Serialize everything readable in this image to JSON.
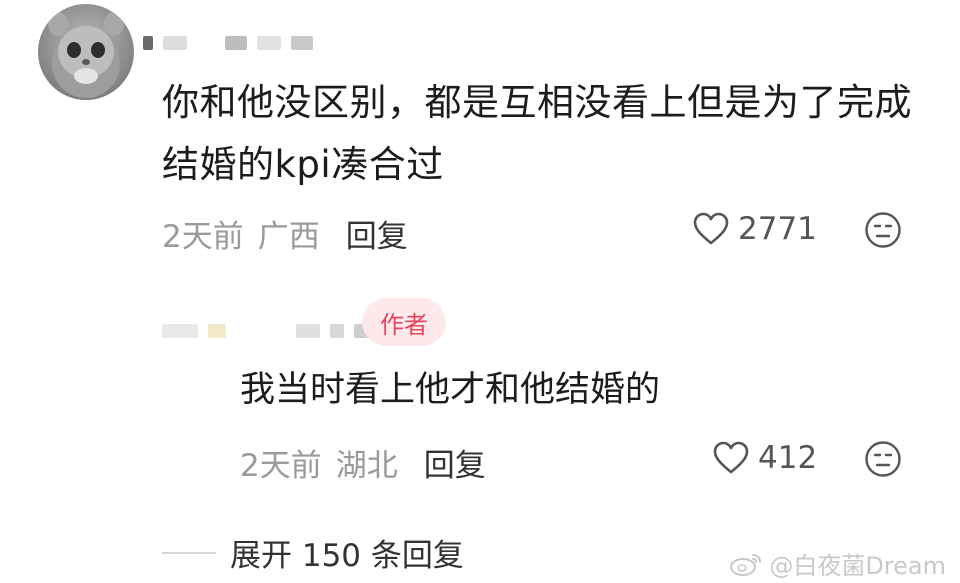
{
  "comment": {
    "text": "你和他没区别，都是互相没看上但是为了完成结婚的kpi凑合过",
    "time": "2天前",
    "location": "广西",
    "reply_label": "回复",
    "likes": "2771",
    "icons": {
      "like": "heart-outline-icon",
      "react": "neutral-face-icon"
    }
  },
  "reply": {
    "badge": "作者",
    "text": "我当时看上他才和他结婚的",
    "time": "2天前",
    "location": "湖北",
    "reply_label": "回复",
    "likes": "412",
    "icons": {
      "like": "heart-outline-icon",
      "react": "neutral-face-icon"
    }
  },
  "expand_replies": "展开 150 条回复",
  "watermark": "@白夜菌Dream",
  "colors": {
    "author_badge_bg": "#fde9ec",
    "author_badge_text": "#e6455f",
    "meta_gray": "#9a9a9a"
  }
}
